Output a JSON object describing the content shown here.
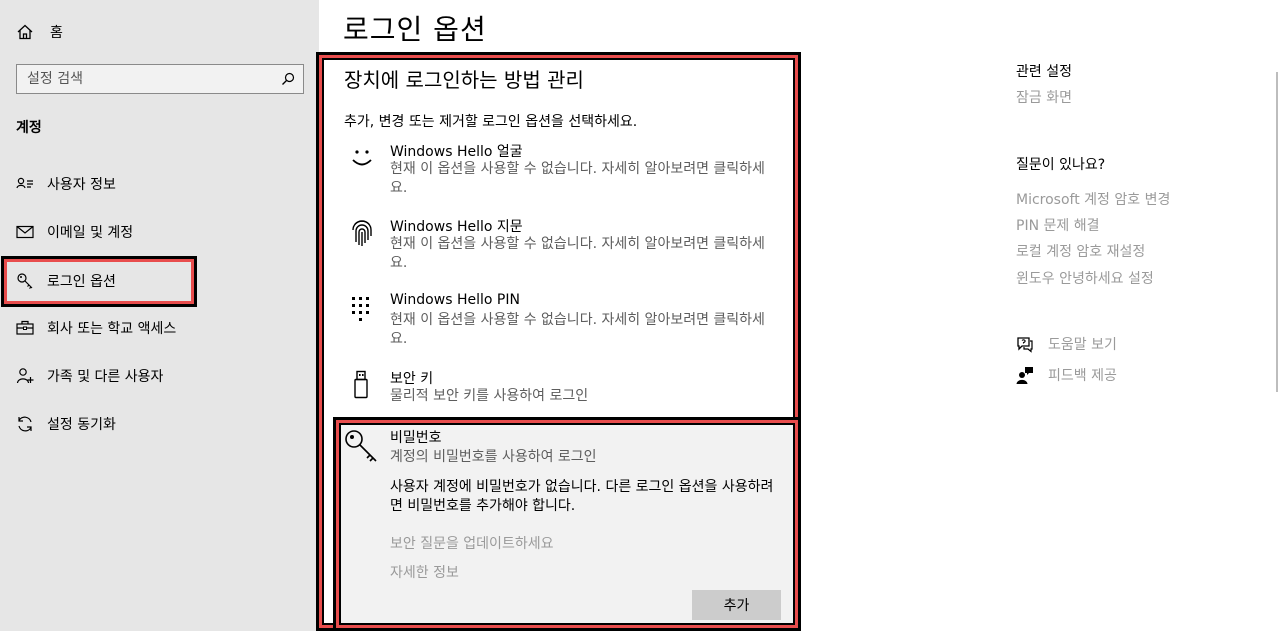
{
  "sidebar": {
    "home_label": "홈",
    "search_placeholder": "설정 검색",
    "section_title": "계정",
    "items": [
      {
        "label": "사용자 정보",
        "icon": "person-card-icon"
      },
      {
        "label": "이메일 및 계정",
        "icon": "mail-icon"
      },
      {
        "label": "로그인 옵션",
        "icon": "key-icon"
      },
      {
        "label": "회사 또는 학교 액세스",
        "icon": "briefcase-icon"
      },
      {
        "label": "가족 및 다른 사용자",
        "icon": "person-add-icon"
      },
      {
        "label": "설정 동기화",
        "icon": "sync-icon"
      }
    ],
    "active_index": 2
  },
  "main": {
    "page_title": "로그인 옵션",
    "subtitle": "장치에 로그인하는 방법 관리",
    "description": "추가, 변경 또는 제거할 로그인 옵션을 선택하세요.",
    "options": [
      {
        "name": "Windows Hello 얼굴",
        "info": "현재 이 옵션을 사용할 수 없습니다. 자세히 알아보려면 클릭하세요.",
        "icon": "face-icon"
      },
      {
        "name": "Windows Hello 지문",
        "info": "현재 이 옵션을 사용할 수 없습니다. 자세히 알아보려면 클릭하세요.",
        "icon": "fingerprint-icon"
      },
      {
        "name": "Windows Hello PIN",
        "info": "현재 이 옵션을 사용할 수 없습니다. 자세히 알아보려면 클릭하세요.",
        "icon": "pin-keypad-icon"
      },
      {
        "name": "보안 키",
        "info": "물리적 보안 키를 사용하여 로그인",
        "icon": "usb-key-icon"
      }
    ],
    "password": {
      "name": "비밀번호",
      "info": "계정의 비밀번호를 사용하여 로그인",
      "message": "사용자 계정에 비밀번호가 없습니다. 다른 로그인 옵션을 사용하려면 비밀번호를 추가해야 합니다.",
      "link_security_questions": "보안 질문을 업데이트하세요",
      "link_more_info": "자세한 정보",
      "add_button": "추가",
      "icon": "password-key-icon"
    }
  },
  "right": {
    "related_title": "관련 설정",
    "related_links": [
      "잠금 화면"
    ],
    "question_title": "질문이 있나요?",
    "question_links": [
      "Microsoft 계정 암호 변경",
      "PIN 문제 해결",
      "로컬 계정 암호 재설정",
      "윈도우 안녕하세요 설정"
    ],
    "help_label": "도움말 보기",
    "feedback_label": "피드백 제공"
  }
}
